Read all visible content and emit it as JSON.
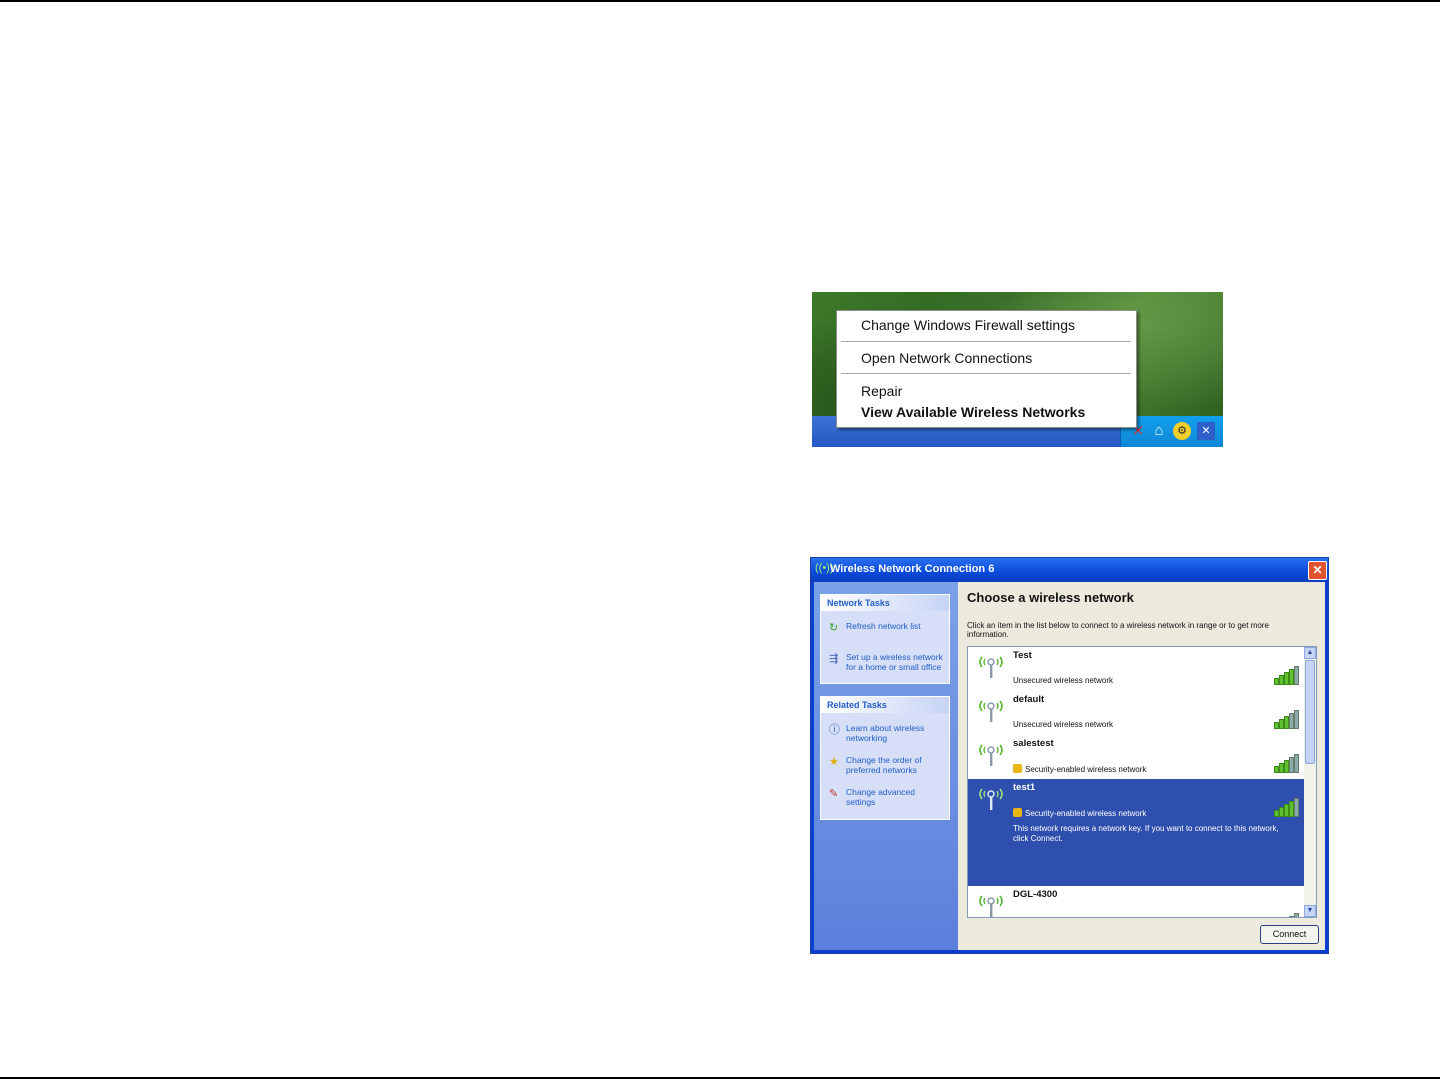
{
  "context_menu": {
    "items": [
      {
        "label": "Change Windows Firewall settings",
        "bold": false
      },
      {
        "label": "Open Network Connections",
        "bold": false
      },
      {
        "label": "Repair",
        "bold": false
      },
      {
        "label": "View Available Wireless Networks",
        "bold": true
      }
    ],
    "tray_icons": [
      "wireless-disconnected-icon",
      "home-icon",
      "security-shield-icon",
      "network-disconnected-icon"
    ]
  },
  "dialog": {
    "title": "Wireless Network Connection 6",
    "title_icon": "wireless-icon",
    "close_icon": "close-icon",
    "heading": "Choose a wireless network",
    "instruction": "Click an item in the list below to connect to a wireless network in range or to get more information.",
    "network_tasks": {
      "title": "Network Tasks",
      "items": [
        {
          "label": "Refresh network list",
          "icon": "refresh-icon"
        },
        {
          "label": "Set up a wireless network for a home or small office",
          "icon": "setup-wireless-icon"
        }
      ]
    },
    "related_tasks": {
      "title": "Related Tasks",
      "items": [
        {
          "label": "Learn about wireless networking",
          "icon": "info-icon"
        },
        {
          "label": "Change the order of preferred networks",
          "icon": "star-icon"
        },
        {
          "label": "Change advanced settings",
          "icon": "settings-icon"
        }
      ]
    },
    "networks": [
      {
        "name": "Test",
        "status": "Unsecured wireless network",
        "secured": false,
        "signal": 4,
        "selected": false,
        "description": ""
      },
      {
        "name": "default",
        "status": "Unsecured wireless network",
        "secured": false,
        "signal": 3,
        "selected": false,
        "description": ""
      },
      {
        "name": "salestest",
        "status": "Security-enabled wireless network",
        "secured": true,
        "signal": 3,
        "selected": false,
        "description": ""
      },
      {
        "name": "test1",
        "status": "Security-enabled wireless network",
        "secured": true,
        "signal": 4,
        "selected": true,
        "description": "This network requires a network key. If you want to connect to this network, click Connect."
      },
      {
        "name": "DGL-4300",
        "status": "",
        "secured": false,
        "signal": 1,
        "selected": false,
        "description": ""
      }
    ],
    "connect_label": "Connect"
  }
}
